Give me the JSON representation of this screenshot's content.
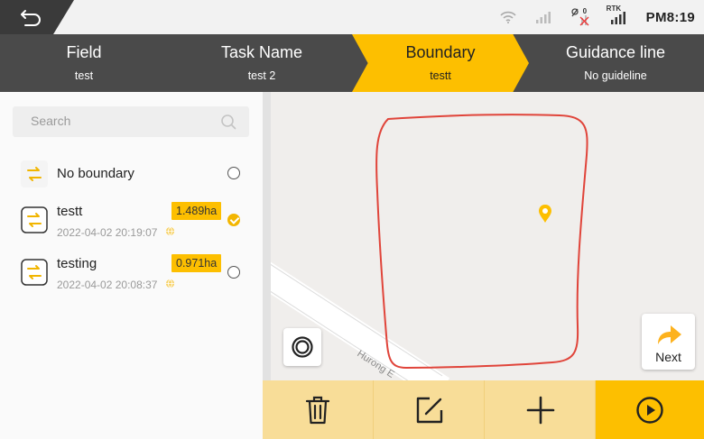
{
  "status": {
    "time": "PM8:19",
    "rtk_label": "RTK",
    "satellite_count": "0"
  },
  "steps": [
    {
      "name": "Field",
      "value": "test"
    },
    {
      "name": "Task Name",
      "value": "test 2"
    },
    {
      "name": "Boundary",
      "value": "testt"
    },
    {
      "name": "Guidance line",
      "value": "No guideline"
    }
  ],
  "search": {
    "placeholder": "Search"
  },
  "boundaries": [
    {
      "title": "No boundary",
      "date": "",
      "area": "",
      "selected": false
    },
    {
      "title": "testt",
      "date": "2022-04-02 20:19:07",
      "area": "1.489ha",
      "selected": true
    },
    {
      "title": "testing",
      "date": "2022-04-02 20:08:37",
      "area": "0.971ha",
      "selected": false
    }
  ],
  "map": {
    "street_label": "Hurong E",
    "next_label": "Next"
  },
  "colors": {
    "accent": "#fdbf00",
    "header_bg": "#4a4a4a",
    "toolbar_bg": "#f8dd98",
    "boundary_line": "#e0443a"
  },
  "icons": [
    "back-icon",
    "wifi-icon",
    "signal-icon",
    "satellite-icon",
    "rtk-signal-icon",
    "search-icon",
    "boundary-icon",
    "globe-icon",
    "location-pin-icon",
    "locate-icon",
    "next-arrow-icon",
    "trash-icon",
    "edit-icon",
    "plus-icon",
    "play-icon"
  ]
}
